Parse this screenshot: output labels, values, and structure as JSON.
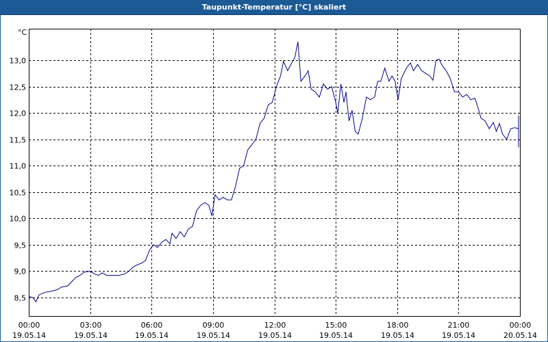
{
  "window": {
    "title": "Taupunkt-Temperatur [°C] skaliert"
  },
  "colors": {
    "title_bar": "#1c5a96",
    "line": "#00008b",
    "grid": "#000000"
  },
  "chart_data": {
    "type": "line",
    "title": "Taupunkt-Temperatur [°C] skaliert",
    "ylabel": "°C",
    "xlabel": "",
    "ylim": [
      8.3,
      13.6
    ],
    "xlim": [
      0,
      24
    ],
    "grid": true,
    "legend": "none",
    "y_ticks": [
      {
        "value": 8.5,
        "label": "8,5"
      },
      {
        "value": 9.0,
        "label": "9,0"
      },
      {
        "value": 9.5,
        "label": "9,5"
      },
      {
        "value": 10.0,
        "label": "10,0"
      },
      {
        "value": 10.5,
        "label": "10,5"
      },
      {
        "value": 11.0,
        "label": "11,0"
      },
      {
        "value": 11.5,
        "label": "11,5"
      },
      {
        "value": 12.0,
        "label": "12,0"
      },
      {
        "value": 12.5,
        "label": "12,5"
      },
      {
        "value": 13.0,
        "label": "13,0"
      }
    ],
    "x_ticks": [
      {
        "value": 0,
        "time": "00:00",
        "date": "19.05.14"
      },
      {
        "value": 3,
        "time": "03:00",
        "date": "19.05.14"
      },
      {
        "value": 6,
        "time": "06:00",
        "date": "19.05.14"
      },
      {
        "value": 9,
        "time": "09:00",
        "date": "19.05.14"
      },
      {
        "value": 12,
        "time": "12:00",
        "date": "19.05.14"
      },
      {
        "value": 15,
        "time": "15:00",
        "date": "19.05.14"
      },
      {
        "value": 18,
        "time": "18:00",
        "date": "19.05.14"
      },
      {
        "value": 21,
        "time": "21:00",
        "date": "19.05.14"
      },
      {
        "value": 24,
        "time": "00:00",
        "date": "20.05.14"
      }
    ],
    "series": [
      {
        "points": [
          [
            0.0,
            8.52
          ],
          [
            0.2,
            8.5
          ],
          [
            0.35,
            8.42
          ],
          [
            0.5,
            8.55
          ],
          [
            0.8,
            8.6
          ],
          [
            1.1,
            8.62
          ],
          [
            1.4,
            8.65
          ],
          [
            1.6,
            8.7
          ],
          [
            1.9,
            8.72
          ],
          [
            2.1,
            8.8
          ],
          [
            2.3,
            8.88
          ],
          [
            2.5,
            8.92
          ],
          [
            2.7,
            8.98
          ],
          [
            3.0,
            9.0
          ],
          [
            3.2,
            8.95
          ],
          [
            3.4,
            8.92
          ],
          [
            3.6,
            8.97
          ],
          [
            3.8,
            8.92
          ],
          [
            4.1,
            8.92
          ],
          [
            4.4,
            8.92
          ],
          [
            4.7,
            8.95
          ],
          [
            4.9,
            9.0
          ],
          [
            5.1,
            9.08
          ],
          [
            5.3,
            9.12
          ],
          [
            5.5,
            9.15
          ],
          [
            5.7,
            9.2
          ],
          [
            5.9,
            9.4
          ],
          [
            6.1,
            9.5
          ],
          [
            6.3,
            9.45
          ],
          [
            6.5,
            9.55
          ],
          [
            6.7,
            9.6
          ],
          [
            6.9,
            9.52
          ],
          [
            7.0,
            9.72
          ],
          [
            7.2,
            9.62
          ],
          [
            7.4,
            9.75
          ],
          [
            7.6,
            9.65
          ],
          [
            7.8,
            9.8
          ],
          [
            8.0,
            9.85
          ],
          [
            8.2,
            10.15
          ],
          [
            8.4,
            10.25
          ],
          [
            8.6,
            10.3
          ],
          [
            8.8,
            10.25
          ],
          [
            8.95,
            10.05
          ],
          [
            9.1,
            10.45
          ],
          [
            9.3,
            10.35
          ],
          [
            9.5,
            10.4
          ],
          [
            9.7,
            10.35
          ],
          [
            9.9,
            10.35
          ],
          [
            10.1,
            10.6
          ],
          [
            10.3,
            10.95
          ],
          [
            10.5,
            11.0
          ],
          [
            10.7,
            11.3
          ],
          [
            10.9,
            11.4
          ],
          [
            11.1,
            11.5
          ],
          [
            11.3,
            11.8
          ],
          [
            11.5,
            11.9
          ],
          [
            11.7,
            12.15
          ],
          [
            11.9,
            12.2
          ],
          [
            12.1,
            12.5
          ],
          [
            12.3,
            12.7
          ],
          [
            12.45,
            12.98
          ],
          [
            12.65,
            12.8
          ],
          [
            12.85,
            12.95
          ],
          [
            13.0,
            13.05
          ],
          [
            13.15,
            13.35
          ],
          [
            13.3,
            12.6
          ],
          [
            13.5,
            12.7
          ],
          [
            13.65,
            12.8
          ],
          [
            13.8,
            12.45
          ],
          [
            14.0,
            12.4
          ],
          [
            14.2,
            12.3
          ],
          [
            14.4,
            12.55
          ],
          [
            14.6,
            12.45
          ],
          [
            14.8,
            12.5
          ],
          [
            15.0,
            12.2
          ],
          [
            15.1,
            12.0
          ],
          [
            15.25,
            12.55
          ],
          [
            15.4,
            12.2
          ],
          [
            15.5,
            12.4
          ],
          [
            15.65,
            11.85
          ],
          [
            15.8,
            12.05
          ],
          [
            15.95,
            11.65
          ],
          [
            16.1,
            11.6
          ],
          [
            16.3,
            11.9
          ],
          [
            16.5,
            12.3
          ],
          [
            16.7,
            12.25
          ],
          [
            16.9,
            12.3
          ],
          [
            17.05,
            12.6
          ],
          [
            17.2,
            12.6
          ],
          [
            17.4,
            12.85
          ],
          [
            17.6,
            12.6
          ],
          [
            17.75,
            12.7
          ],
          [
            17.9,
            12.6
          ],
          [
            18.05,
            12.25
          ],
          [
            18.2,
            12.65
          ],
          [
            18.45,
            12.85
          ],
          [
            18.65,
            12.95
          ],
          [
            18.8,
            12.8
          ],
          [
            19.0,
            12.92
          ],
          [
            19.2,
            12.8
          ],
          [
            19.4,
            12.75
          ],
          [
            19.6,
            12.7
          ],
          [
            19.75,
            12.62
          ],
          [
            19.9,
            13.0
          ],
          [
            20.05,
            13.02
          ],
          [
            20.2,
            12.9
          ],
          [
            20.4,
            12.8
          ],
          [
            20.6,
            12.65
          ],
          [
            20.8,
            12.4
          ],
          [
            21.0,
            12.4
          ],
          [
            21.2,
            12.3
          ],
          [
            21.4,
            12.35
          ],
          [
            21.6,
            12.25
          ],
          [
            21.8,
            12.28
          ],
          [
            21.95,
            12.1
          ],
          [
            22.1,
            11.9
          ],
          [
            22.3,
            11.85
          ],
          [
            22.5,
            11.7
          ],
          [
            22.7,
            11.82
          ],
          [
            22.85,
            11.65
          ],
          [
            23.0,
            11.8
          ],
          [
            23.15,
            11.6
          ],
          [
            23.35,
            11.5
          ],
          [
            23.55,
            11.7
          ],
          [
            23.75,
            11.72
          ],
          [
            23.95,
            11.7
          ],
          [
            24.1,
            11.75
          ],
          [
            24.3,
            11.35
          ],
          [
            24.5,
            11.95
          ]
        ]
      }
    ]
  }
}
